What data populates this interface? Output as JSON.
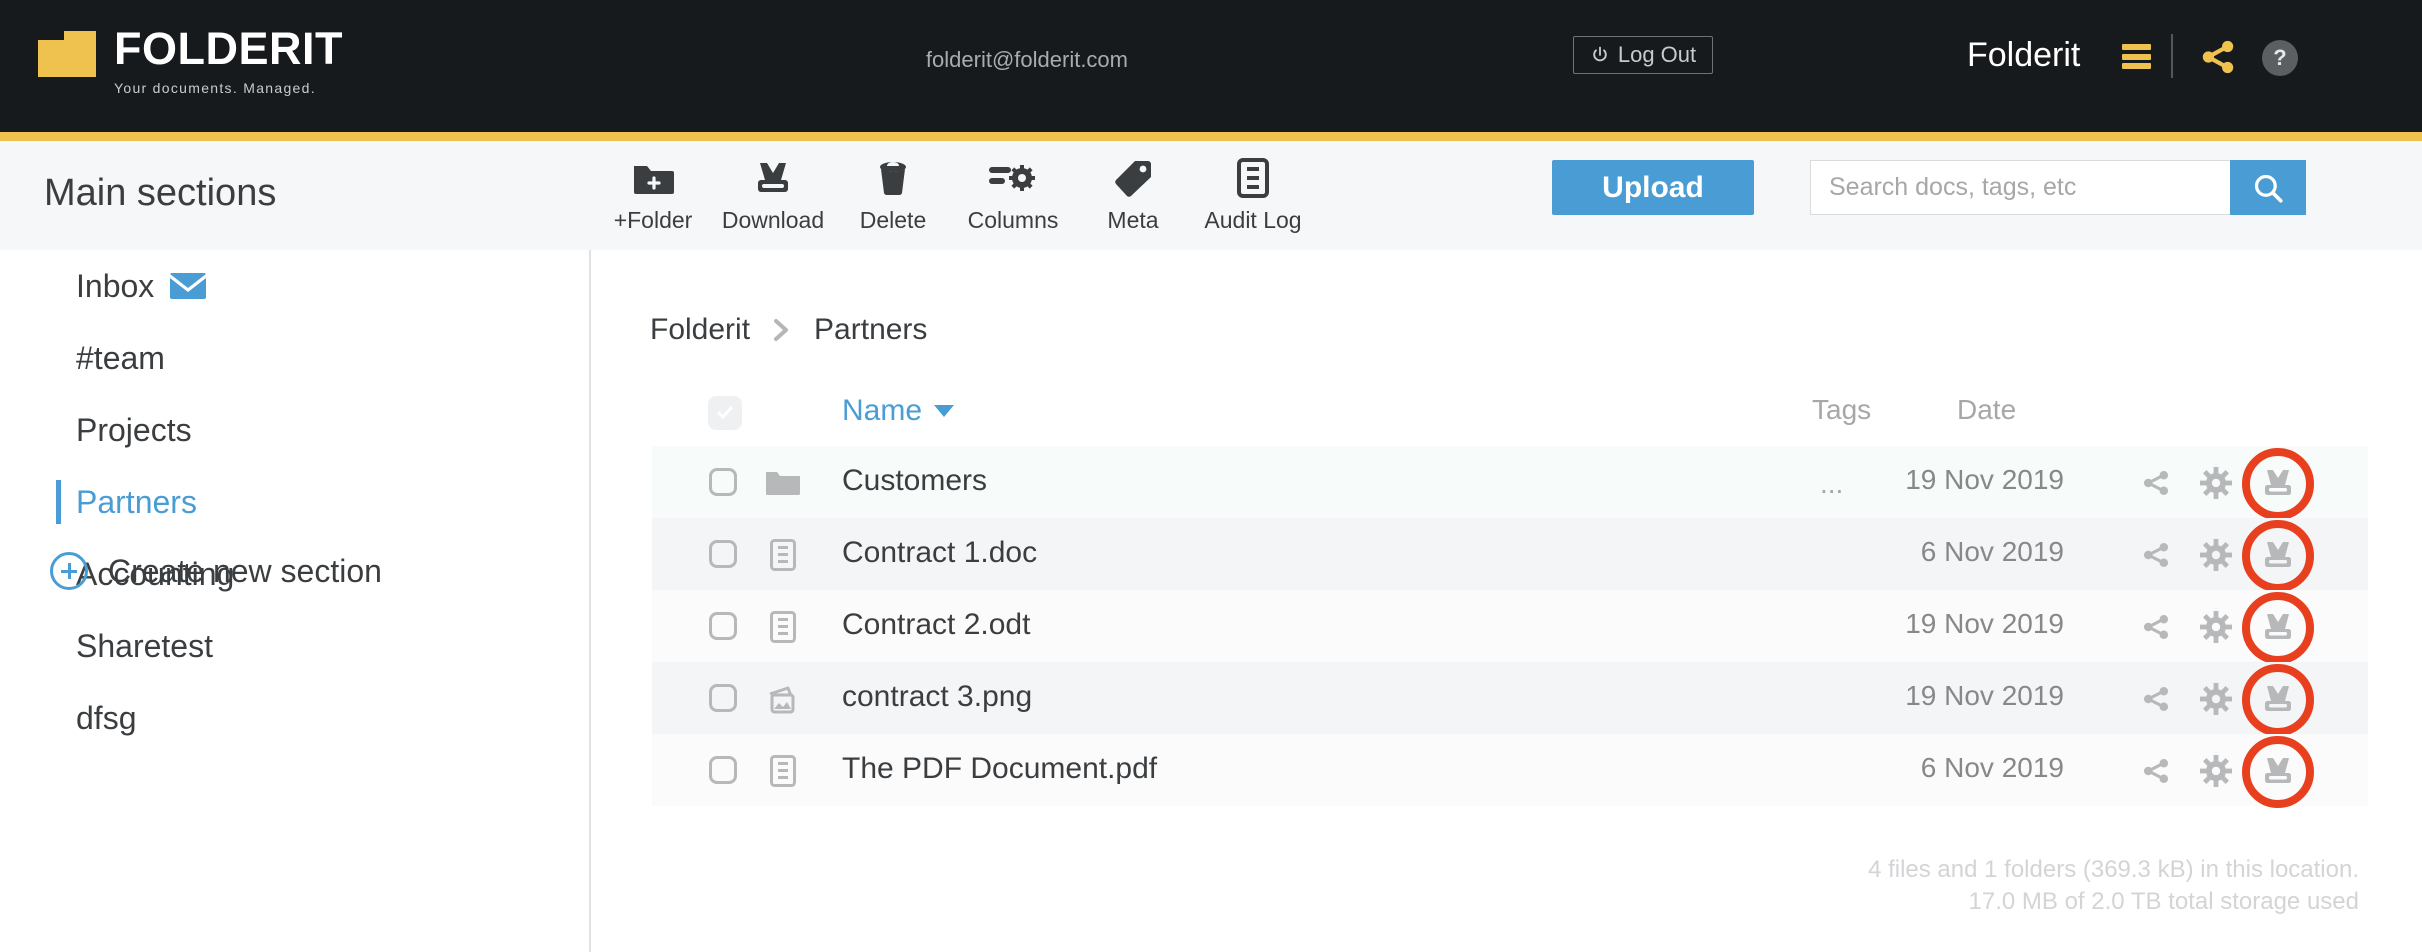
{
  "header": {
    "logo_text": "FOLDERIT",
    "logo_tagline": "Your documents. Managed.",
    "email": "folderit@folderit.com",
    "logout_label": "Log Out",
    "power_icon": "power-icon",
    "brand_name": "Folderit",
    "burger_icon": "hamburger-menu-icon",
    "share_icon": "share-icon",
    "help_label": "?",
    "accent_yellow": "#efc14e",
    "bar_color": "#171a1c"
  },
  "toolbar": {
    "title": "Main sections",
    "tools": [
      {
        "label": "+Folder",
        "icon": "add-folder-icon"
      },
      {
        "label": "Download",
        "icon": "download-icon"
      },
      {
        "label": "Delete",
        "icon": "trash-icon"
      },
      {
        "label": "Columns",
        "icon": "columns-settings-icon"
      },
      {
        "label": "Meta",
        "icon": "tag-icon"
      },
      {
        "label": "Audit Log",
        "icon": "document-list-icon"
      }
    ],
    "upload_label": "Upload",
    "upload_color": "#4a9cd4"
  },
  "search": {
    "placeholder": "Search docs, tags, etc",
    "value": "",
    "button_icon": "search-icon"
  },
  "sidebar": {
    "items": [
      {
        "label": "Inbox",
        "active": false,
        "icon": "envelope-icon"
      },
      {
        "label": "#team",
        "active": false,
        "icon": ""
      },
      {
        "label": "Projects",
        "active": false,
        "icon": ""
      },
      {
        "label": "Partners",
        "active": true,
        "icon": ""
      },
      {
        "label": "Accounting",
        "active": false,
        "icon": ""
      },
      {
        "label": "Sharetest",
        "active": false,
        "icon": ""
      },
      {
        "label": "dfsg",
        "active": false,
        "icon": ""
      }
    ],
    "create_label": "Create new section",
    "create_icon": "plus-circle-icon",
    "active_color": "#4a9cd4"
  },
  "breadcrumb": {
    "items": [
      "Folderit",
      "Partners"
    ],
    "separator_icon": "chevron-right-icon"
  },
  "table": {
    "columns": {
      "select_all_icon": "checkbox-checked-icon",
      "name": "Name",
      "sort_icon": "caret-down-icon",
      "tags": "Tags",
      "date": "Date"
    },
    "rows": [
      {
        "name": "Customers",
        "icon": "folder-icon",
        "tags": "...",
        "date": "19 Nov 2019",
        "highlighted": true
      },
      {
        "name": "Contract 1.doc",
        "icon": "document-icon",
        "tags": "",
        "date": "6 Nov 2019",
        "highlighted": true
      },
      {
        "name": "Contract 2.odt",
        "icon": "document-icon",
        "tags": "",
        "date": "19 Nov 2019",
        "highlighted": true
      },
      {
        "name": "contract 3.png",
        "icon": "image-icon",
        "tags": "",
        "date": "19 Nov 2019",
        "highlighted": true
      },
      {
        "name": "The PDF Document.pdf",
        "icon": "document-icon",
        "tags": "",
        "date": "6 Nov 2019",
        "highlighted": true
      }
    ],
    "row_actions": {
      "share_icon": "share-icon",
      "settings_icon": "gear-icon",
      "download_icon": "download-tray-icon"
    },
    "highlight_color": "#e8401f"
  },
  "footer": {
    "line1": "4 files and 1 folders (369.3 kB) in this location.",
    "line2": "17.0 MB of 2.0 TB total storage used"
  }
}
